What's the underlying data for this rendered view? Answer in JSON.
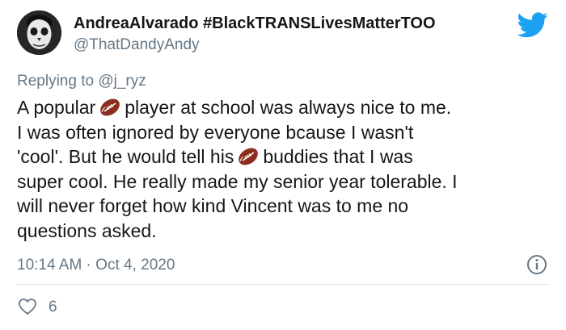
{
  "author": {
    "display_name": "AndreaAlvarado #BlackTRANSLivesMatterTOO",
    "handle": "@ThatDandyAndy",
    "avatar_icon": "skull-face-avatar"
  },
  "platform_icon": "twitter-bird-icon",
  "reply": {
    "prefix": "Replying to ",
    "mention": "@j_ryz"
  },
  "body": {
    "line1_a": "A popular",
    "line1_b": "player at school was always nice to me.",
    "line2": "I was often ignored by everyone bcause I wasn't",
    "line3_a": "'cool'. But he would tell his",
    "line3_b": "buddies that I was",
    "line4": "super cool. He really made my senior year tolerable. I",
    "line5": "will never forget how kind Vincent was to me no",
    "line6": "questions asked.",
    "emoji": "american-football-emoji"
  },
  "meta": {
    "timestamp": "10:14 AM · Oct 4, 2020"
  },
  "actions": {
    "like_count": "6"
  },
  "colors": {
    "text": "#14171a",
    "secondary": "#657786",
    "twitter_blue": "#1da1f2",
    "divider": "#e1e8ed",
    "football": "#8b2e1f"
  }
}
